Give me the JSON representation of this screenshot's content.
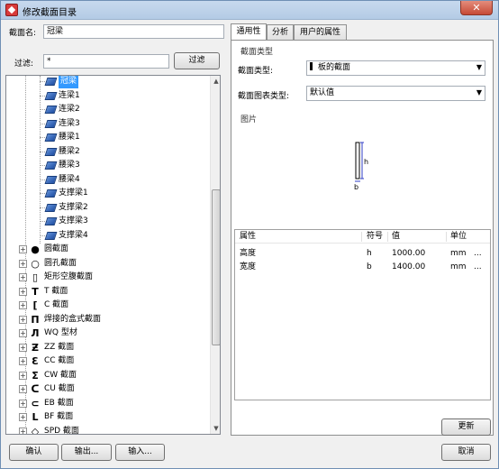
{
  "window": {
    "title": "修改截面目录",
    "close_label": "✕"
  },
  "section_name": {
    "label": "截面名:",
    "value": "冠梁"
  },
  "filter": {
    "label": "过滤:",
    "value": "*",
    "button": "过滤"
  },
  "tree": {
    "beam_items": [
      "冠梁",
      "连梁1",
      "连梁2",
      "连梁3",
      "腰梁1",
      "腰梁2",
      "腰梁3",
      "腰梁4",
      "支撑梁1",
      "支撑梁2",
      "支撑梁3",
      "支撑梁4"
    ],
    "categories": [
      {
        "label": "圆截面",
        "glyph": "●"
      },
      {
        "label": "圆孔截面",
        "glyph": "○"
      },
      {
        "label": "矩形空腹截面",
        "glyph": "▯"
      },
      {
        "label": "T 截面",
        "glyph": "T"
      },
      {
        "label": "C 截面",
        "glyph": "["
      },
      {
        "label": "焊接的盒式截面",
        "glyph": "Π"
      },
      {
        "label": "WQ 型材",
        "glyph": "Л"
      },
      {
        "label": "ZZ 截面",
        "glyph": "Ƶ"
      },
      {
        "label": "CC 截面",
        "glyph": "Ɛ"
      },
      {
        "label": "CW 截面",
        "glyph": "Σ"
      },
      {
        "label": "CU 截面",
        "glyph": "ᑕ"
      },
      {
        "label": "EB 截面",
        "glyph": "⊂"
      },
      {
        "label": "BF 截面",
        "glyph": "L"
      },
      {
        "label": "SPD 截面",
        "glyph": "◇"
      }
    ]
  },
  "tabs": [
    "通用性",
    "分析",
    "用户的属性"
  ],
  "general": {
    "group_section_type": "截面类型",
    "section_type_label": "截面类型:",
    "section_type_value": "板的截面",
    "chart_type_label": "截面图表类型:",
    "chart_type_value": "默认值",
    "group_picture": "图片",
    "dim_h": "h",
    "dim_b": "b"
  },
  "properties": {
    "headers": [
      "属性",
      "符号",
      "值",
      "单位"
    ],
    "rows": [
      {
        "name": "高度",
        "symbol": "h",
        "value": "1000.00",
        "unit": "mm",
        "more": "..."
      },
      {
        "name": "宽度",
        "symbol": "b",
        "value": "1400.00",
        "unit": "mm",
        "more": "..."
      }
    ]
  },
  "buttons": {
    "update": "更新",
    "ok": "确认",
    "export": "输出...",
    "import": "输入...",
    "cancel": "取消"
  }
}
